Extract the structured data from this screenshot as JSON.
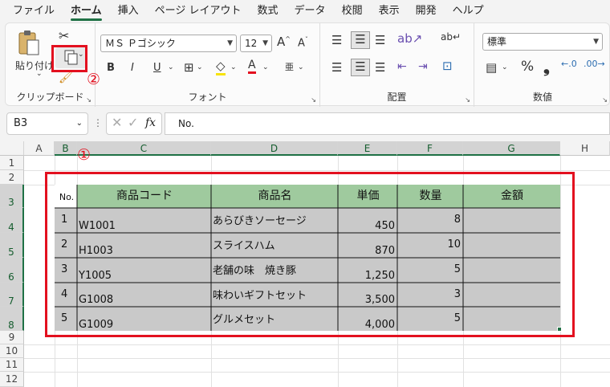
{
  "menu": {
    "tabs": [
      "ファイル",
      "ホーム",
      "挿入",
      "ページ レイアウト",
      "数式",
      "データ",
      "校閲",
      "表示",
      "開発",
      "ヘルプ"
    ],
    "active": "ホーム"
  },
  "ribbon": {
    "clipboard": {
      "label": "クリップボード",
      "paste_label": "貼り付け"
    },
    "font": {
      "label": "フォント",
      "font_name": "ＭＳ Ｐゴシック",
      "font_size": "12",
      "bold": "B",
      "italic": "I",
      "underline": "U",
      "grow": "A",
      "shrink": "A",
      "font_color_glyph": "A",
      "phonetic": "亜"
    },
    "alignment": {
      "label": "配置"
    },
    "number": {
      "label": "数値",
      "format": "標準",
      "percent": "%",
      "comma": "❟"
    }
  },
  "formula_bar": {
    "name_box": "B3",
    "fx": "fx",
    "content": "No."
  },
  "columns": [
    "A",
    "B",
    "C",
    "D",
    "E",
    "F",
    "G",
    "H"
  ],
  "rows": [
    "1",
    "2",
    "3",
    "4",
    "5",
    "6",
    "7",
    "8",
    "9",
    "10",
    "11",
    "12"
  ],
  "table": {
    "headers": [
      "No.",
      "商品コード",
      "商品名",
      "単価",
      "数量",
      "金額"
    ],
    "rows": [
      [
        "1",
        "W1001",
        "あらびきソーセージ",
        "450",
        "8",
        ""
      ],
      [
        "2",
        "H1003",
        "スライスハム",
        "870",
        "10",
        ""
      ],
      [
        "3",
        "Y1005",
        "老舗の味　焼き豚",
        "1,250",
        "5",
        ""
      ],
      [
        "4",
        "G1008",
        "味わいギフトセット",
        "3,500",
        "3",
        ""
      ],
      [
        "5",
        "G1009",
        "グルメセット",
        "4,000",
        "5",
        ""
      ]
    ]
  },
  "annotations": {
    "marker1": "①",
    "marker2": "②"
  },
  "colors": {
    "accent": "#1f7145",
    "header_fill": "#9fca9e",
    "data_fill": "#c9c9c9",
    "annotation_red": "#e3101f"
  }
}
